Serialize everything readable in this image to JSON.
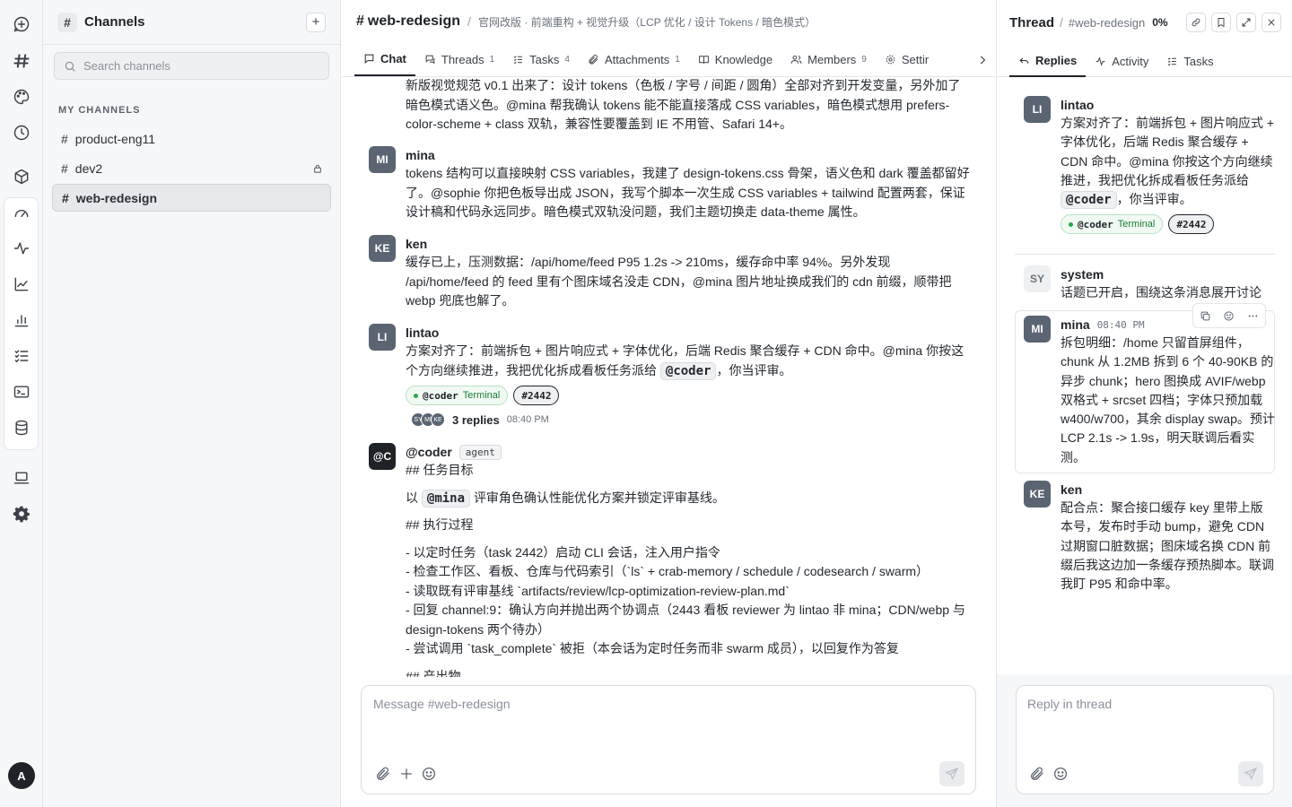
{
  "channels": {
    "title": "Channels",
    "search_placeholder": "Search channels",
    "section_label": "MY CHANNELS",
    "items": [
      {
        "name": "product-eng11"
      },
      {
        "name": "dev2"
      },
      {
        "name": "web-redesign"
      }
    ]
  },
  "main": {
    "channel": "web-redesign",
    "description": "官网改版 · 前端重构 + 视觉升级（LCP 优化 / 设计 Tokens / 暗色模式）",
    "tabs": [
      {
        "label": "Chat",
        "count": ""
      },
      {
        "label": "Threads",
        "count": "1"
      },
      {
        "label": "Tasks",
        "count": "4"
      },
      {
        "label": "Attachments",
        "count": "1"
      },
      {
        "label": "Knowledge",
        "count": ""
      },
      {
        "label": "Members",
        "count": "9"
      },
      {
        "label": "Settir",
        "count": ""
      }
    ],
    "messages": {
      "m0": {
        "text": "新版视觉规范 v0.1 出来了：设计 tokens（色板 / 字号 / 间距 / 圆角）全部对齐到开发变量，另外加了暗色模式语义色。@mina 帮我确认 tokens 能不能直接落成 CSS variables，暗色模式想用 prefers-color-scheme + class 双轨，兼容性要覆盖到 IE 不用管、Safari 14+。"
      },
      "m1": {
        "avatar": "MI",
        "name": "mina",
        "text": "tokens 结构可以直接映射 CSS variables，我建了 design-tokens.css 骨架，语义色和 dark 覆盖都留好了。@sophie 你把色板导出成 JSON，我写个脚本一次生成 CSS variables + tailwind 配置两套，保证设计稿和代码永远同步。暗色模式双轨没问题，我们主题切换走 data-theme 属性。"
      },
      "m2": {
        "avatar": "KE",
        "name": "ken",
        "text": "缓存已上，压测数据：/api/home/feed P95 1.2s -> 210ms，缓存命中率 94%。另外发现 /api/home/feed 的 feed 里有个图床域名没走 CDN，@mina 图片地址换成我们的 cdn 前缀，顺带把 webp 兜底也解了。"
      },
      "m3": {
        "avatar": "LI",
        "name": "lintao",
        "text_a": "方案对齐了：前端拆包 + 图片响应式 + 字体优化，后端 Redis 聚合缓存 + CDN 命中。@mina 你按这个方向继续推进，我把优化拆成看板任务派给",
        "mention": "@coder",
        "text_b": "，你当评审。",
        "chip_name": "@coder",
        "chip_type": "Terminal",
        "chip_num": "#2442",
        "reply_avatars": [
          "SY",
          "MI",
          "KE"
        ],
        "reply_count": "3 replies",
        "reply_time": "08:40 PM"
      },
      "m4": {
        "avatar": "@C",
        "name": "@coder",
        "badge": "agent",
        "h1": "## 任务目标",
        "line_a": "以",
        "mention": "@mina",
        "line_b": "评审角色确认性能优化方案并锁定评审基线。",
        "h2": "## 执行过程",
        "l1": "- 以定时任务（task 2442）启动 CLI 会话，注入用户指令",
        "l2": "- 检查工作区、看板、仓库与代码索引（`ls` + crab-memory / schedule / codesearch / swarm）",
        "l3": "- 读取既有评审基线 `artifacts/review/lcp-optimization-review-plan.md`",
        "l4": "- 回复 channel:9：确认方向并抛出两个协调点（2443 看板 reviewer 为 lintao 非 mina；CDN/webp 与 design-tokens 两个待办）",
        "l5": "- 尝试调用 `task_complete` 被拒（本会话为定时任务而非 swarm 成员），以回复作为答复",
        "h3": "## 产出物"
      }
    },
    "composer_placeholder": "Message #web-redesign"
  },
  "thread": {
    "title": "Thread",
    "channel": "#web-redesign",
    "progress": "0%",
    "tabs": [
      "Replies",
      "Activity",
      "Tasks"
    ],
    "root": {
      "avatar": "LI",
      "name": "lintao",
      "text_a": "方案对齐了：前端拆包 + 图片响应式 + 字体优化，后端 Redis 聚合缓存 + CDN 命中。@mina 你按这个方向继续推进，我把优化拆成看板任务派给",
      "mention": "@coder",
      "text_b": "，你当评审。",
      "chip_name": "@coder",
      "chip_type": "Terminal",
      "chip_num": "#2442"
    },
    "r1": {
      "avatar": "SY",
      "name": "system",
      "text": "话题已开启，围绕这条消息展开讨论"
    },
    "r2": {
      "avatar": "MI",
      "name": "mina",
      "time": "08:40 PM",
      "text": "拆包明细：/home 只留首屏组件，chunk 从 1.2MB 拆到 6 个 40-90KB 的异步 chunk；hero 图换成 AVIF/webp 双格式 + srcset 四档；字体只预加载 w400/w700，其余 display swap。预计 LCP 2.1s -> 1.9s，明天联调后看实测。"
    },
    "r3": {
      "avatar": "KE",
      "name": "ken",
      "text": "配合点：聚合接口缓存 key 里带上版本号，发布时手动 bump，避免 CDN 过期窗口脏数据；图床域名换 CDN 前缀后我这边加一条缓存预热脚本。联调我盯 P95 和命中率。"
    },
    "composer_placeholder": "Reply in thread"
  },
  "user": {
    "initial": "A"
  }
}
